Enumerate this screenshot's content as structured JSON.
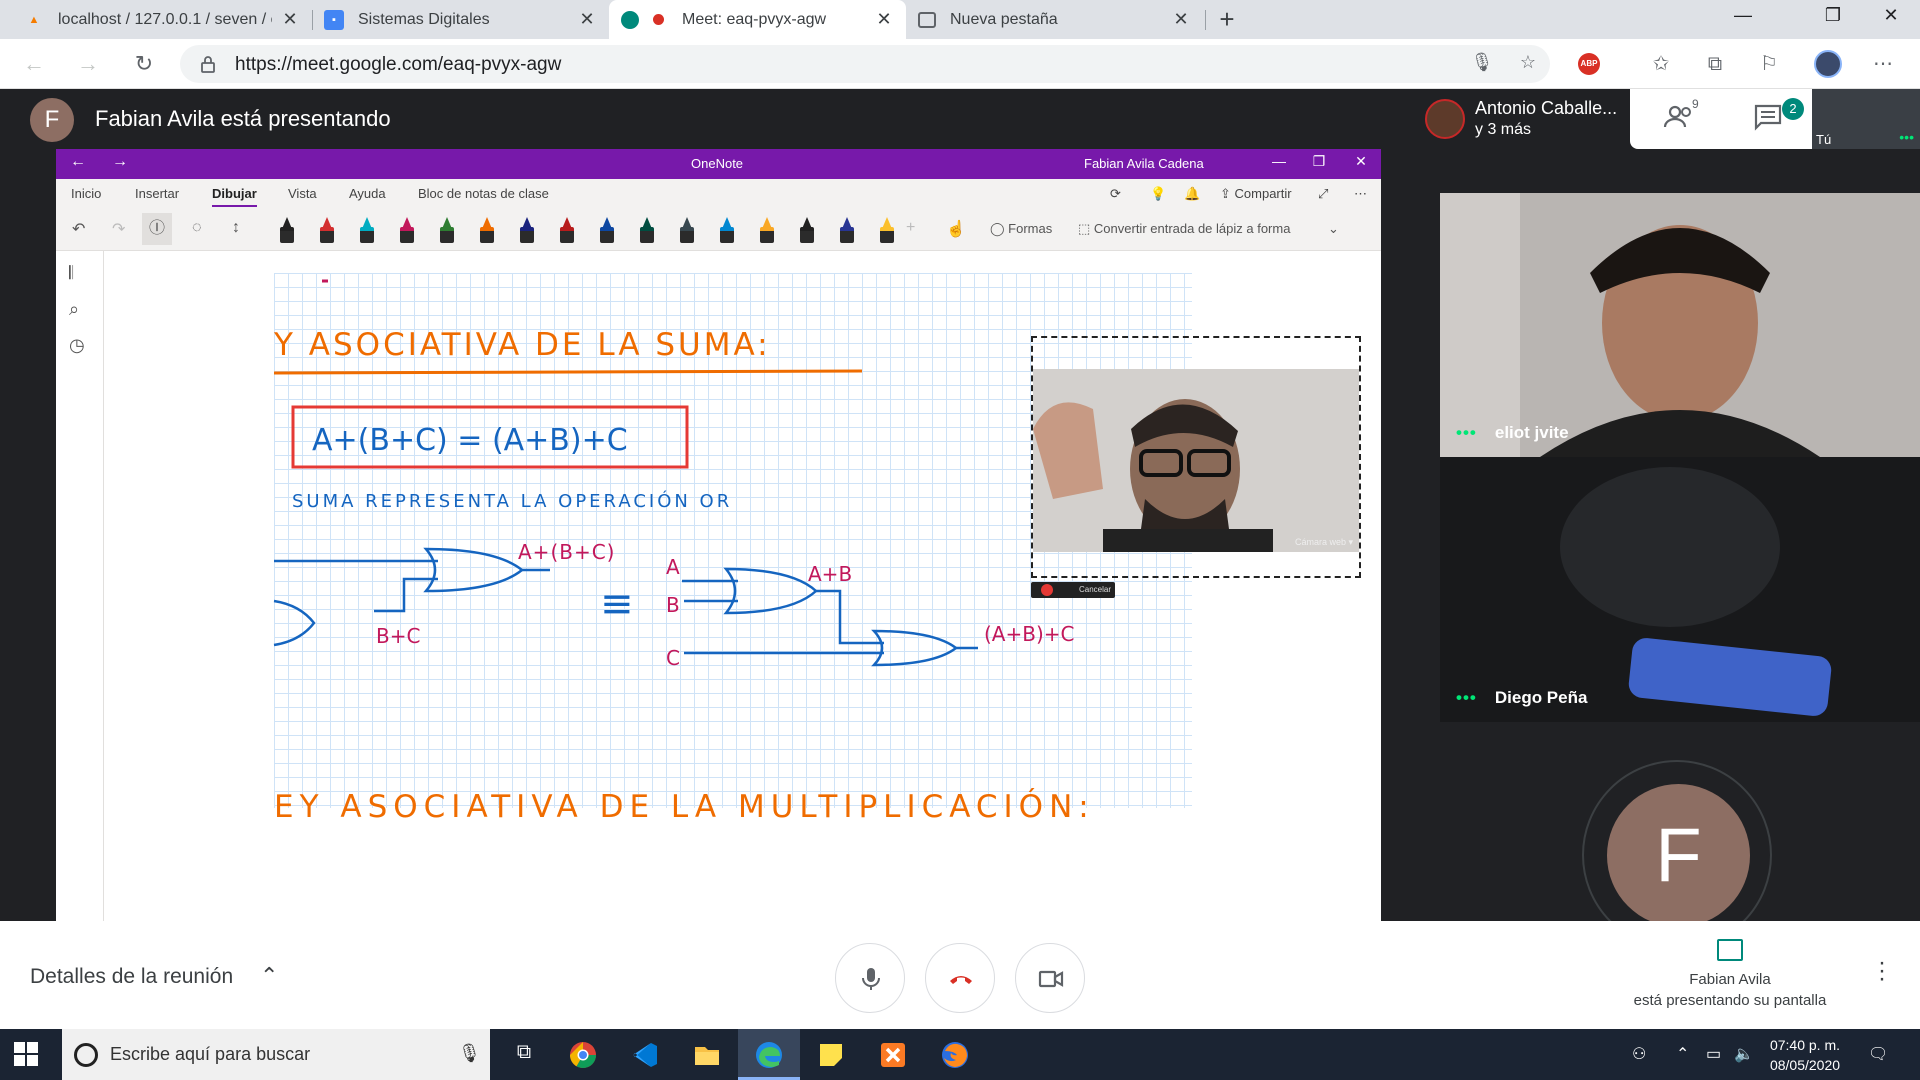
{
  "browser": {
    "tabs": [
      {
        "title": "localhost / 127.0.0.1 / seven / co",
        "icon": "phpmyadmin-icon"
      },
      {
        "title": "Sistemas Digitales",
        "icon": "classroom-icon"
      },
      {
        "title": "Meet: eaq-pvyx-agw",
        "icon": "meet-icon",
        "active": true
      },
      {
        "title": "Nueva pestaña",
        "icon": "newtab-page-icon"
      }
    ],
    "url": "https://meet.google.com/eaq-pvyx-agw",
    "abp_label": "ABP"
  },
  "meet": {
    "presenter_initial": "F",
    "presenter_text": "Fabian Avila está presentando",
    "people_name": "Antonio Caballe...",
    "people_more": "y 3 más",
    "people_count": "9",
    "chat_badge": "2",
    "self_label": "Tú",
    "participants": [
      {
        "name": "eliot jvite"
      },
      {
        "name": "Diego Peña"
      }
    ],
    "avatar_initial": "F",
    "details_label": "Detalles de la reunión",
    "presenting_name": "Fabian Avila",
    "presenting_sub": "está presentando su pantalla"
  },
  "onenote": {
    "app_title": "OneNote",
    "user": "Fabian Avila Cadena",
    "menu": [
      "Inicio",
      "Insertar",
      "Dibujar",
      "Vista",
      "Ayuda",
      "Bloc de notas de clase"
    ],
    "share_label": "Compartir",
    "shapes_label": "Formas",
    "convert_label": "Convertir entrada de lápiz a forma",
    "pen_colors": [
      "#222222",
      "#d32f2f",
      "#00acc1",
      "#c2185b",
      "#2e7d32",
      "#ef6c00",
      "#1a237e",
      "#b71c1c",
      "#0d47a1",
      "#004d40",
      "#37474f",
      "#0288d1",
      "#f9a825",
      "#212121",
      "#283593",
      "#fbc02d"
    ]
  },
  "whiteboard": {
    "heading": "Y ASOCIATIVA DE LA SUMA:",
    "formula": "A+(B+C) = (A+B)+C",
    "subtitle": "SUMA REPRESENTA LA OPERACIÓN OR",
    "g1_out": "A+(B+C)",
    "g1_in": "B+C",
    "eq": "≡",
    "in_a": "A",
    "in_b": "B",
    "in_c": "C",
    "g2_out": "A+B",
    "g3_out": "(A+B)+C",
    "next_heading": "EY ASOCIATIVA DE LA MULTIPLICACIÓN:"
  },
  "webcam": {
    "label": "Cámara web ▾",
    "cancel_label": "Cancelar"
  },
  "taskbar": {
    "search_placeholder": "Escribe aquí para buscar",
    "time": "07:40 p. m.",
    "date": "08/05/2020"
  }
}
